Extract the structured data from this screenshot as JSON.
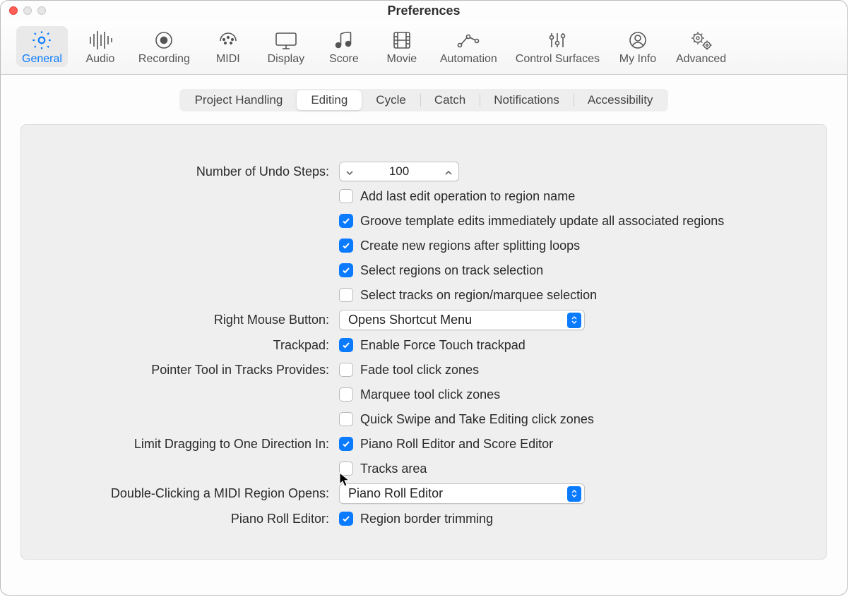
{
  "window": {
    "title": "Preferences"
  },
  "toolbar": {
    "items": [
      {
        "label": "General"
      },
      {
        "label": "Audio"
      },
      {
        "label": "Recording"
      },
      {
        "label": "MIDI"
      },
      {
        "label": "Display"
      },
      {
        "label": "Score"
      },
      {
        "label": "Movie"
      },
      {
        "label": "Automation"
      },
      {
        "label": "Control Surfaces"
      },
      {
        "label": "My Info"
      },
      {
        "label": "Advanced"
      }
    ]
  },
  "subtabs": [
    "Project Handling",
    "Editing",
    "Cycle",
    "Catch",
    "Notifications",
    "Accessibility"
  ],
  "form": {
    "undo_label": "Number of Undo Steps:",
    "undo_value": "100",
    "opt1": "Add last edit operation to region name",
    "opt2": "Groove template edits immediately update all associated regions",
    "opt3": "Create new regions after splitting loops",
    "opt4": "Select regions on track selection",
    "opt5": "Select tracks on region/marquee selection",
    "rmb_label": "Right Mouse Button:",
    "rmb_value": "Opens Shortcut Menu",
    "trackpad_label": "Trackpad:",
    "trackpad_opt": "Enable Force Touch trackpad",
    "pointer_label": "Pointer Tool in Tracks Provides:",
    "pointer_opt1": "Fade tool click zones",
    "pointer_opt2": "Marquee tool click zones",
    "pointer_opt3": "Quick Swipe and Take Editing click zones",
    "limit_label": "Limit Dragging to One Direction In:",
    "limit_opt1": "Piano Roll Editor and Score Editor",
    "limit_opt2": "Tracks area",
    "dblclick_label": "Double-Clicking a MIDI Region Opens:",
    "dblclick_value": "Piano Roll Editor",
    "pre_label": "Piano Roll Editor:",
    "pre_opt": "Region border trimming"
  }
}
